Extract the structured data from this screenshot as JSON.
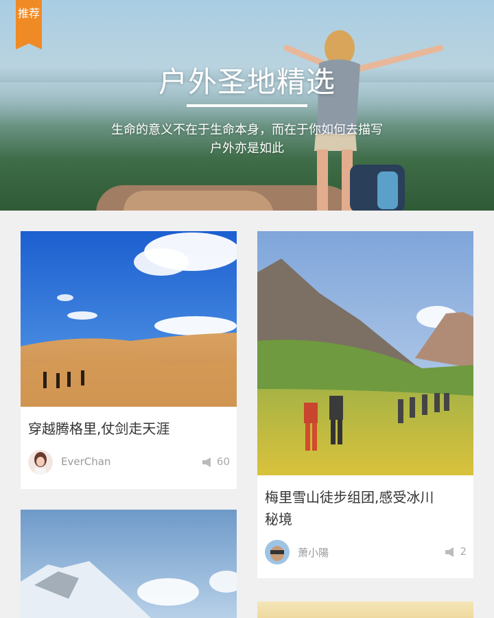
{
  "hero": {
    "badge": "推荐",
    "title": "户外圣地精选",
    "subtitle_line1": "生命的意义不在于生命本身，而在于你如何去描写",
    "subtitle_line2": "户外亦是如此"
  },
  "cards": [
    {
      "title": "穿越腾格里,仗剑走天涯",
      "author": "EverChan",
      "likes": "60"
    },
    {
      "title_line1": "梅里雪山徒步组团,感受冰川",
      "title_line2": "秘境",
      "author": "萧小陽",
      "likes": "2"
    }
  ],
  "colors": {
    "accent": "#f08a24",
    "background": "#f0f0f0"
  }
}
